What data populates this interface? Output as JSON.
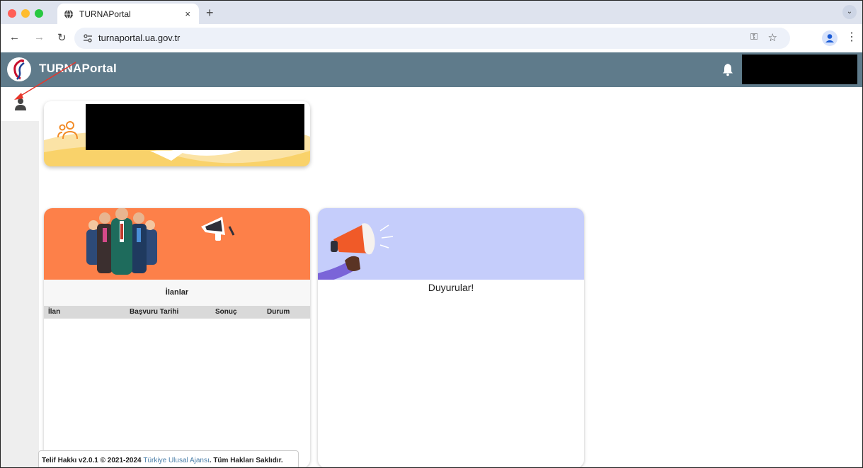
{
  "browser": {
    "tab_title": "TURNAPortal",
    "tab_close": "×",
    "new_tab": "+",
    "url": "turnaportal.ua.gov.tr",
    "traffic_lights": [
      "#ff5f57",
      "#febc2e",
      "#28c840"
    ]
  },
  "app": {
    "name": "TURNAPortal",
    "header_color": "#5f7b8b"
  },
  "ilanlar": {
    "title": "İlanlar",
    "columns": [
      "İlan",
      "Başvuru Tarihi",
      "Sonuç",
      "Durum"
    ],
    "rows": []
  },
  "duyurular": {
    "title": "Duyurular!"
  },
  "footer": {
    "prefix": "Telif Hakkı v2.0.1 © 2021-2024 ",
    "link": "Türkiye Ulusal Ajansı",
    "suffix": ". Tüm Hakları Saklıdır."
  },
  "icons": {
    "sidebar": "user-icon",
    "header": "bell-icon",
    "profile_card": "people-icon"
  }
}
